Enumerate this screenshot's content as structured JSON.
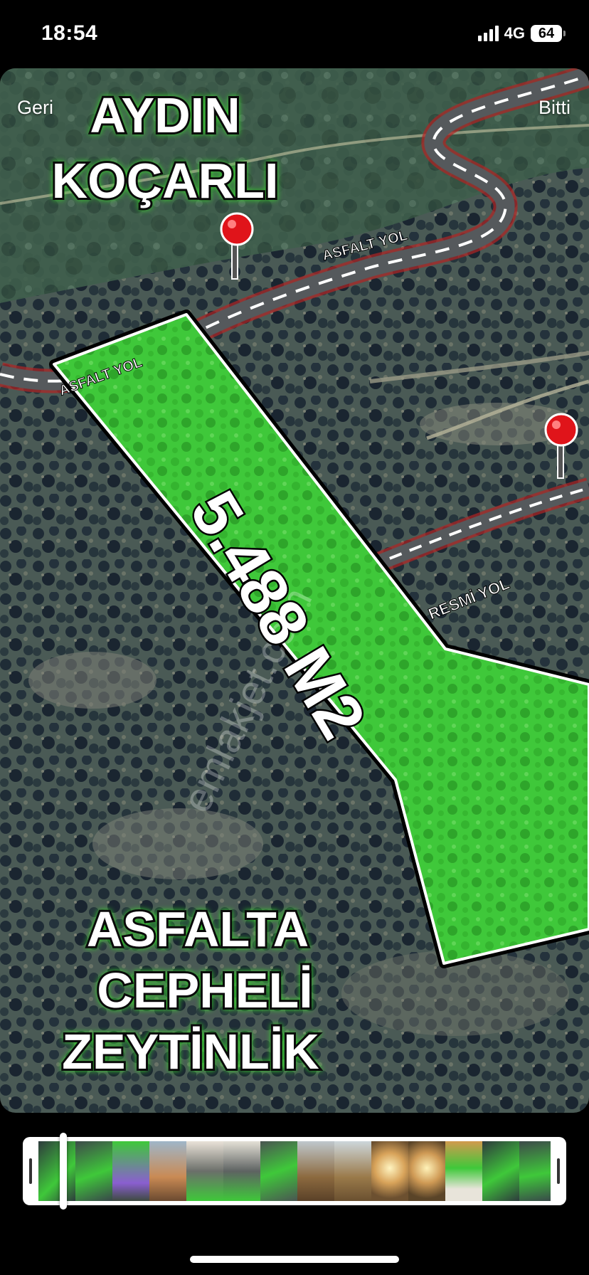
{
  "status_bar": {
    "time": "18:54",
    "network": "4G",
    "battery": "64"
  },
  "nav": {
    "back_label": "Geri",
    "done_label": "Bitti"
  },
  "photo": {
    "title_line1": "AYDIN",
    "title_line2": "KOÇARLI",
    "road_label_1": "ASFALT YOL",
    "road_label_2": "ASFALT YOL",
    "road_label_3": "RESMİ YOL",
    "area_label": "5.488 M2",
    "caption_line1": "ASFALTA",
    "caption_line2": "CEPHELİ",
    "caption_line3": "ZEYTİNLİK",
    "watermark": "emlakjet.com",
    "icons": [
      "map-pin-icon",
      "map-pin-icon"
    ],
    "colors": {
      "parcel": "#3cc83a",
      "title_glow": "#38d12e",
      "pin": "#e0141a"
    }
  },
  "filmstrip": {
    "thumb_count": 14
  }
}
